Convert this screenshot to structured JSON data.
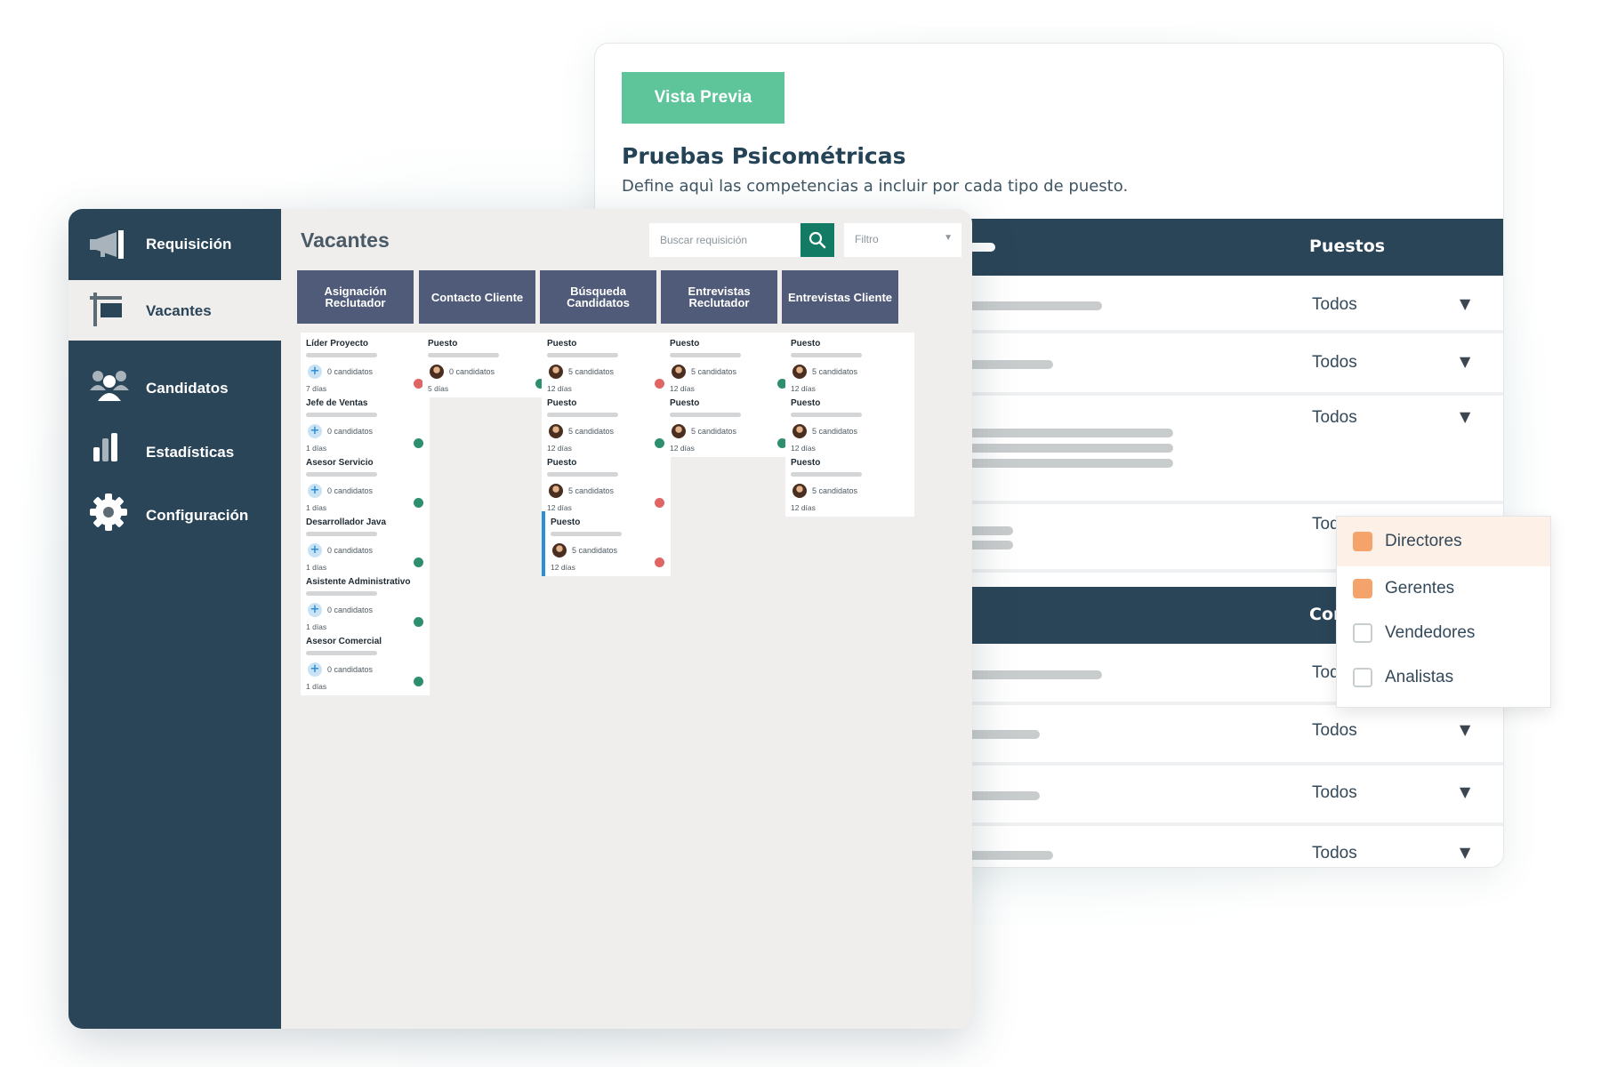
{
  "back_panel": {
    "preview_button": "Vista Previa",
    "title": "Pruebas Psicométricas",
    "subtitle": "Define aquì las competencias a incluir por cada tipo de puesto.",
    "header1_label": "Puestos",
    "header2_label": "Com",
    "rows": [
      {
        "value": "Todos"
      },
      {
        "value": "Todos"
      },
      {
        "value": "Todos"
      },
      {
        "value": "Todos"
      },
      {
        "value": "Todos"
      },
      {
        "value": "Todos"
      },
      {
        "value": "Todos"
      },
      {
        "value": "Todos"
      }
    ],
    "dropdown_options": [
      {
        "label": "Directores",
        "checked": true
      },
      {
        "label": "Gerentes",
        "checked": true
      },
      {
        "label": "Vendedores",
        "checked": false
      },
      {
        "label": "Analistas",
        "checked": false
      }
    ]
  },
  "sidebar": {
    "items": [
      {
        "label": "Requisición",
        "icon": "megaphone-icon",
        "selected": false
      },
      {
        "label": "Vacantes",
        "icon": "signpost-icon",
        "selected": true
      },
      {
        "label": "Candidatos",
        "icon": "users-icon",
        "selected": false
      },
      {
        "label": "Estadísticas",
        "icon": "bar-chart-icon",
        "selected": false
      },
      {
        "label": "Configuración",
        "icon": "gear-icon",
        "selected": false
      }
    ]
  },
  "main": {
    "title": "Vacantes",
    "search_placeholder": "Buscar requisición",
    "filter_label": "Filtro",
    "columns": [
      {
        "title": "Asignación Reclutador",
        "cards": [
          {
            "title": "Líder Proyecto",
            "count": "0 candidatos",
            "days": "7 días",
            "status": "red",
            "icon": "plus"
          },
          {
            "title": "Jefe de Ventas",
            "count": "0 candidatos",
            "days": "1 días",
            "status": "green",
            "icon": "plus"
          },
          {
            "title": "Asesor Servicio",
            "count": "0 candidatos",
            "days": "1 días",
            "status": "green",
            "icon": "plus"
          },
          {
            "title": "Desarrollador Java",
            "count": "0 candidatos",
            "days": "1 días",
            "status": "green",
            "icon": "plus"
          },
          {
            "title": "Asistente Administrativo",
            "count": "0 candidatos",
            "days": "1 días",
            "status": "green",
            "icon": "plus"
          },
          {
            "title": "Asesor Comercial",
            "count": "0 candidatos",
            "days": "1 días",
            "status": "green",
            "icon": "plus"
          }
        ]
      },
      {
        "title": "Contacto Cliente",
        "cards": [
          {
            "title": "Puesto",
            "count": "0 candidatos",
            "days": "5 días",
            "status": "green",
            "icon": "avatar"
          }
        ]
      },
      {
        "title": "Búsqueda Candidatos",
        "cards": [
          {
            "title": "Puesto",
            "count": "5 candidatos",
            "days": "12 días",
            "status": "red",
            "icon": "avatar"
          },
          {
            "title": "Puesto",
            "count": "5 candidatos",
            "days": "12 días",
            "status": "green",
            "icon": "avatar"
          },
          {
            "title": "Puesto",
            "count": "5 candidatos",
            "days": "12 días",
            "status": "red",
            "icon": "avatar"
          },
          {
            "title": "Puesto",
            "count": "5 candidatos",
            "days": "12 días",
            "status": "red",
            "icon": "avatar",
            "highlight": true
          }
        ]
      },
      {
        "title": "Entrevistas Reclutador",
        "cards": [
          {
            "title": "Puesto",
            "count": "5 candidatos",
            "days": "12 días",
            "status": "green",
            "icon": "avatar"
          },
          {
            "title": "Puesto",
            "count": "5 candidatos",
            "days": "12 días",
            "status": "green",
            "icon": "avatar"
          }
        ]
      },
      {
        "title": "Entrevistas Cliente",
        "cards": [
          {
            "title": "Puesto",
            "count": "5 candidatos",
            "days": "12 días",
            "status": "none",
            "icon": "avatar"
          },
          {
            "title": "Puesto",
            "count": "5 candidatos",
            "days": "12 días",
            "status": "none",
            "icon": "avatar"
          },
          {
            "title": "Puesto",
            "count": "5 candidatos",
            "days": "12 días",
            "status": "none",
            "icon": "avatar"
          }
        ]
      }
    ]
  },
  "colors": {
    "navy": "#2a4558",
    "preview_green": "#5ec59a",
    "search_button": "#137a64",
    "column_header": "#4f5b78",
    "status_red": "#e06565",
    "status_green": "#2e8f6e",
    "checkbox_orange": "#f4a46a",
    "highlight_blue": "#2b8ed6"
  }
}
